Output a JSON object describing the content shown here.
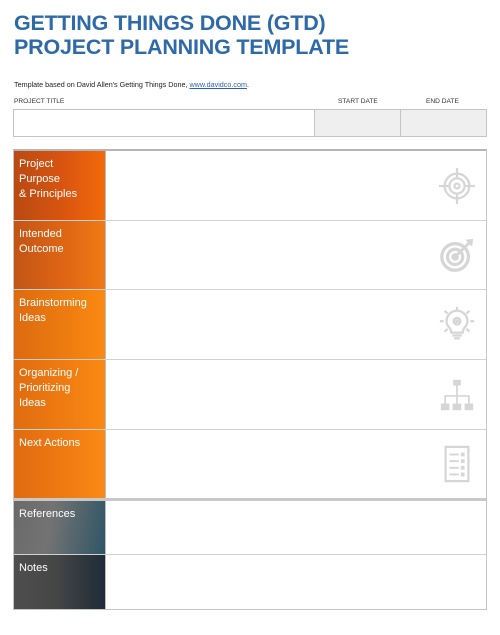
{
  "header": {
    "title_line1": "GETTING THINGS DONE (GTD)",
    "title_line2": "PROJECT PLANNING TEMPLATE",
    "subtitle_prefix": "Template based on David Allen's Getting Things Done, ",
    "subtitle_link": "www.davidco.com",
    "subtitle_suffix": "."
  },
  "project_fields": {
    "project_title_label": "PROJECT TITLE",
    "start_date_label": "START DATE",
    "end_date_label": "END DATE",
    "project_title_value": "",
    "start_date_value": "",
    "end_date_value": ""
  },
  "sections": [
    {
      "label": "Project Purpose & Principles",
      "line1": "Project",
      "line2": "Purpose",
      "line3": "& Principles",
      "icon": "crosshair-icon",
      "value": ""
    },
    {
      "label": "Intended Outcome",
      "line1": "Intended",
      "line2": "Outcome",
      "icon": "target-arrow-icon",
      "value": ""
    },
    {
      "label": "Brainstorming Ideas",
      "line1": "Brainstorming",
      "line2": "Ideas",
      "icon": "lightbulb-gear-icon",
      "value": ""
    },
    {
      "label": "Organizing / Prioritizing Ideas",
      "line1": "Organizing /",
      "line2": "Prioritizing",
      "line3": "Ideas",
      "icon": "org-chart-icon",
      "value": ""
    },
    {
      "label": "Next Actions",
      "line1": "Next Actions",
      "icon": "checklist-icon",
      "value": ""
    },
    {
      "label": "References",
      "line1": "References",
      "value": ""
    },
    {
      "label": "Notes",
      "line1": "Notes",
      "value": ""
    }
  ],
  "colors": {
    "title": "#2e6aa8",
    "link": "#2d5fb8",
    "orange": "#f07d12",
    "dark": "#464646",
    "icon_gray": "#d6d6d6"
  }
}
